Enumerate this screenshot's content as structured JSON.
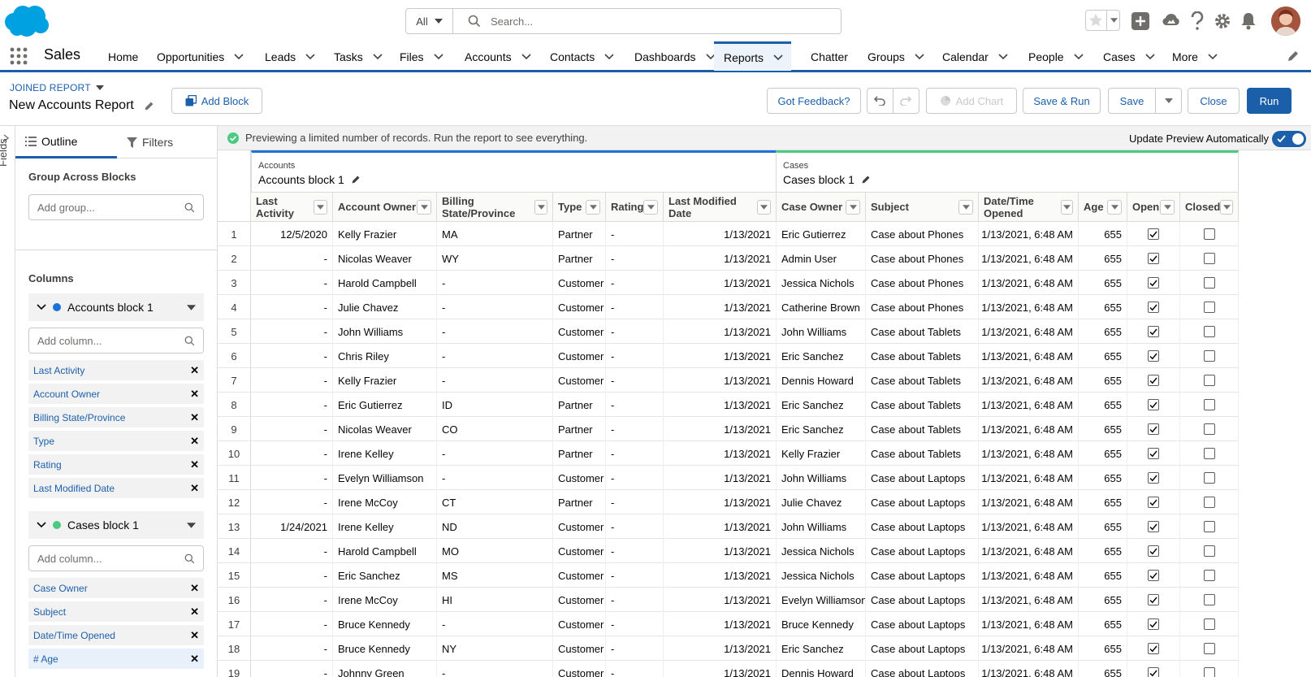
{
  "topbar": {
    "search_scope": "All",
    "search_placeholder": "Search..."
  },
  "nav": {
    "app_name": "Sales",
    "items": [
      {
        "label": "Home",
        "dropdown": false
      },
      {
        "label": "Opportunities",
        "dropdown": true
      },
      {
        "label": "Leads",
        "dropdown": true
      },
      {
        "label": "Tasks",
        "dropdown": true
      },
      {
        "label": "Files",
        "dropdown": true
      },
      {
        "label": "Accounts",
        "dropdown": true
      },
      {
        "label": "Contacts",
        "dropdown": true
      },
      {
        "label": "Dashboards",
        "dropdown": true
      },
      {
        "label": "Reports",
        "dropdown": true,
        "active": true
      },
      {
        "label": "Chatter",
        "dropdown": false
      },
      {
        "label": "Groups",
        "dropdown": true
      },
      {
        "label": "Calendar",
        "dropdown": true
      },
      {
        "label": "People",
        "dropdown": true
      },
      {
        "label": "Cases",
        "dropdown": true
      },
      {
        "label": "More",
        "dropdown": true
      }
    ]
  },
  "header": {
    "report_type": "JOINED REPORT",
    "report_title": "New Accounts Report",
    "add_block": "Add Block",
    "got_feedback": "Got Feedback?",
    "add_chart": "Add Chart",
    "save_run": "Save & Run",
    "save": "Save",
    "close": "Close",
    "run": "Run"
  },
  "side_strip": {
    "label": "Fields"
  },
  "sidebar": {
    "tab_outline": "Outline",
    "tab_filters": "Filters",
    "group_title": "Group Across Blocks",
    "group_placeholder": "Add group...",
    "columns_title": "Columns",
    "column_placeholder": "Add column...",
    "blocks": [
      {
        "name": "Accounts block 1",
        "color": "#1b73d8",
        "columns": [
          "Last Activity",
          "Account Owner",
          "Billing State/Province",
          "Type",
          "Rating",
          "Last Modified Date"
        ]
      },
      {
        "name": "Cases block 1",
        "color": "#4bca81",
        "columns": [
          "Case Owner",
          "Subject",
          "Date/Time Opened",
          "# Age"
        ]
      }
    ]
  },
  "preview": {
    "message": "Previewing a limited number of records. Run the report to see everything.",
    "update_label": "Update Preview Automatically",
    "update_on": true
  },
  "report": {
    "blocks": [
      {
        "type_label": "Accounts",
        "name": "Accounts block 1",
        "accent": "#1b73d8"
      },
      {
        "type_label": "Cases",
        "name": "Cases block 1",
        "accent": "#4bca81"
      }
    ],
    "columns": [
      "Last Activity",
      "Account Owner",
      "Billing State/Province",
      "Type",
      "Rating",
      "Last Modified Date",
      "Case Owner",
      "Subject",
      "Date/Time Opened",
      "Age",
      "Open",
      "Closed"
    ],
    "rows": [
      [
        "12/5/2020",
        "Kelly Frazier",
        "MA",
        "Partner",
        "-",
        "1/13/2021",
        "Eric Gutierrez",
        "Case about Phones",
        "1/13/2021, 6:48 AM",
        "655",
        true,
        false
      ],
      [
        "-",
        "Nicolas Weaver",
        "WY",
        "Partner",
        "-",
        "1/13/2021",
        "Admin User",
        "Case about Phones",
        "1/13/2021, 6:48 AM",
        "655",
        true,
        false
      ],
      [
        "-",
        "Harold Campbell",
        "-",
        "Customer",
        "-",
        "1/13/2021",
        "Jessica Nichols",
        "Case about Phones",
        "1/13/2021, 6:48 AM",
        "655",
        true,
        false
      ],
      [
        "-",
        "Julie Chavez",
        "-",
        "Customer",
        "-",
        "1/13/2021",
        "Catherine Brown",
        "Case about Phones",
        "1/13/2021, 6:48 AM",
        "655",
        true,
        false
      ],
      [
        "-",
        "John Williams",
        "-",
        "Customer",
        "-",
        "1/13/2021",
        "John Williams",
        "Case about Tablets",
        "1/13/2021, 6:48 AM",
        "655",
        true,
        false
      ],
      [
        "-",
        "Chris Riley",
        "-",
        "Customer",
        "-",
        "1/13/2021",
        "Eric Sanchez",
        "Case about Tablets",
        "1/13/2021, 6:48 AM",
        "655",
        true,
        false
      ],
      [
        "-",
        "Kelly Frazier",
        "-",
        "Customer",
        "-",
        "1/13/2021",
        "Dennis Howard",
        "Case about Tablets",
        "1/13/2021, 6:48 AM",
        "655",
        true,
        false
      ],
      [
        "-",
        "Eric Gutierrez",
        "ID",
        "Partner",
        "-",
        "1/13/2021",
        "Eric Sanchez",
        "Case about Tablets",
        "1/13/2021, 6:48 AM",
        "655",
        true,
        false
      ],
      [
        "-",
        "Nicolas Weaver",
        "CO",
        "Partner",
        "-",
        "1/13/2021",
        "Eric Sanchez",
        "Case about Tablets",
        "1/13/2021, 6:48 AM",
        "655",
        true,
        false
      ],
      [
        "-",
        "Irene Kelley",
        "-",
        "Partner",
        "-",
        "1/13/2021",
        "Kelly Frazier",
        "Case about Tablets",
        "1/13/2021, 6:48 AM",
        "655",
        true,
        false
      ],
      [
        "-",
        "Evelyn Williamson",
        "-",
        "Customer",
        "-",
        "1/13/2021",
        "John Williams",
        "Case about Laptops",
        "1/13/2021, 6:48 AM",
        "655",
        true,
        false
      ],
      [
        "-",
        "Irene McCoy",
        "CT",
        "Partner",
        "-",
        "1/13/2021",
        "Julie Chavez",
        "Case about Laptops",
        "1/13/2021, 6:48 AM",
        "655",
        true,
        false
      ],
      [
        "1/24/2021",
        "Irene Kelley",
        "ND",
        "Customer",
        "-",
        "1/13/2021",
        "John Williams",
        "Case about Laptops",
        "1/13/2021, 6:48 AM",
        "655",
        true,
        false
      ],
      [
        "-",
        "Harold Campbell",
        "MO",
        "Customer",
        "-",
        "1/13/2021",
        "Jessica Nichols",
        "Case about Laptops",
        "1/13/2021, 6:48 AM",
        "655",
        true,
        false
      ],
      [
        "-",
        "Eric Sanchez",
        "MS",
        "Customer",
        "-",
        "1/13/2021",
        "Jessica Nichols",
        "Case about Laptops",
        "1/13/2021, 6:48 AM",
        "655",
        true,
        false
      ],
      [
        "-",
        "Irene McCoy",
        "HI",
        "Customer",
        "-",
        "1/13/2021",
        "Evelyn Williamson",
        "Case about Laptops",
        "1/13/2021, 6:48 AM",
        "655",
        true,
        false
      ],
      [
        "-",
        "Bruce Kennedy",
        "-",
        "Customer",
        "-",
        "1/13/2021",
        "Bruce Kennedy",
        "Case about Laptops",
        "1/13/2021, 6:48 AM",
        "655",
        true,
        false
      ],
      [
        "-",
        "Bruce Kennedy",
        "NY",
        "Customer",
        "-",
        "1/13/2021",
        "Eric Sanchez",
        "Case about Laptops",
        "1/13/2021, 6:48 AM",
        "655",
        true,
        false
      ],
      [
        "-",
        "Johnny Green",
        "-",
        "Customer",
        "-",
        "1/13/2021",
        "Dennis Howard",
        "Case about Laptops",
        "1/13/2021, 6:48 AM",
        "655",
        true,
        false
      ]
    ]
  }
}
